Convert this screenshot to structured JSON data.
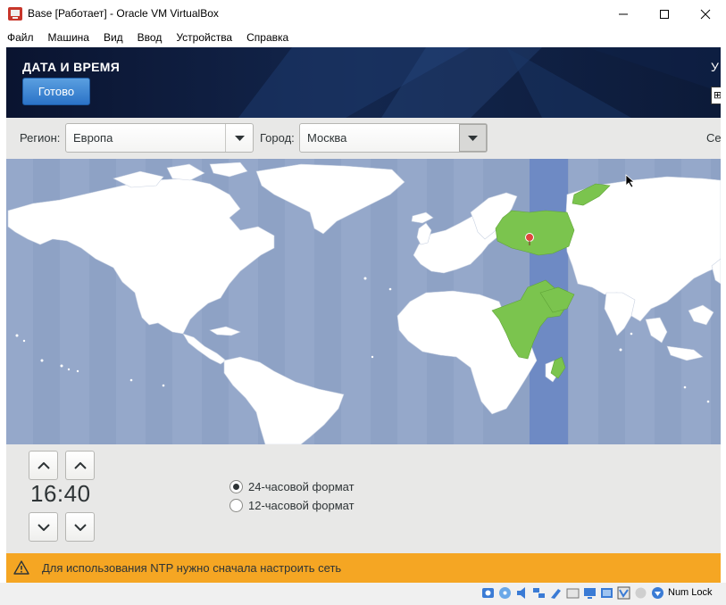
{
  "window": {
    "title": "Base [Работает] - Oracle VM VirtualBox"
  },
  "menu": [
    "Файл",
    "Машина",
    "Вид",
    "Ввод",
    "Устройства",
    "Справка"
  ],
  "header": {
    "title": "ДАТА И ВРЕМЯ",
    "done_label": "Готово",
    "right_letter": "У",
    "right_box": "⊞"
  },
  "toolbar": {
    "region_label": "Регион:",
    "region_value": "Европа",
    "city_label": "Город:",
    "city_value": "Москва",
    "network_label_partial": "Сет"
  },
  "map": {
    "selected_timezone_color": "#8aa0cc",
    "highlight_color": "#7bc44e",
    "ocean_color": "#8ea2c5",
    "land_color": "#ffffff",
    "pin_color": "#e0473e"
  },
  "time": {
    "display": "16:40",
    "format_24": "24-часовой формат",
    "format_12": "12-часовой формат",
    "selected_format": "24"
  },
  "warning": {
    "text": "Для использования NTP нужно сначала настроить сеть",
    "color": "#f5a623"
  },
  "statusbar": {
    "numlock": "Num Lock"
  }
}
